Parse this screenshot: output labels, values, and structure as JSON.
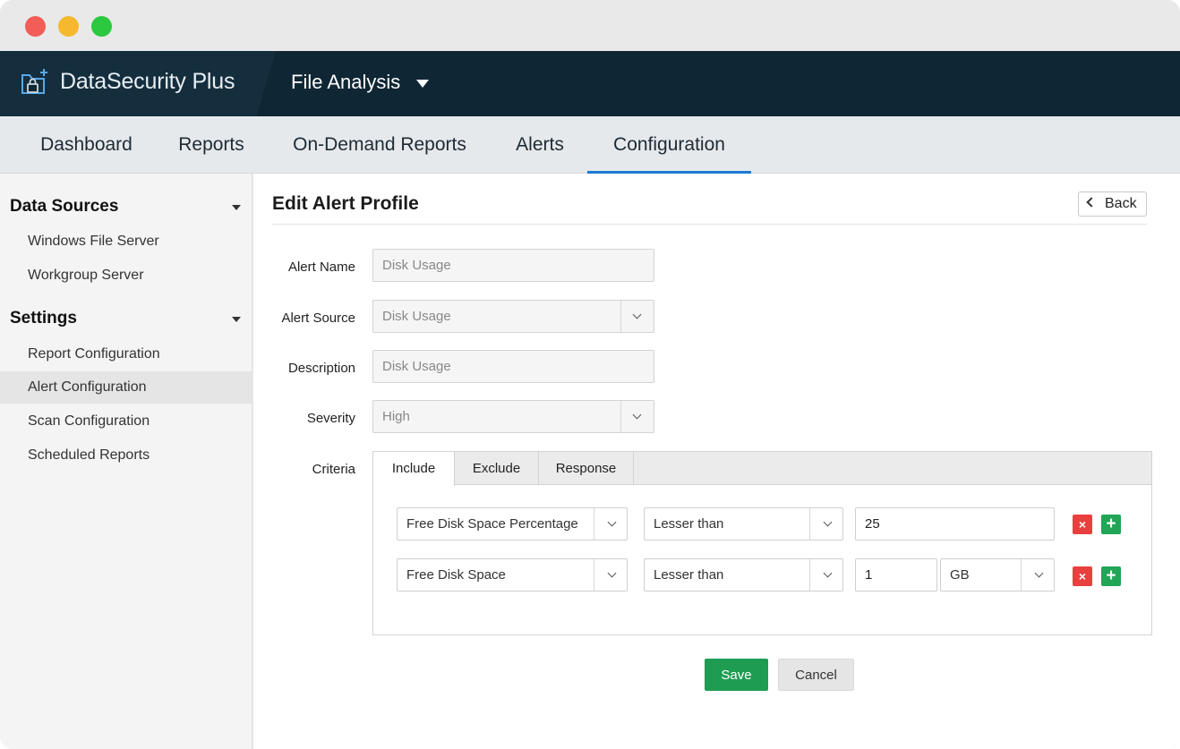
{
  "window": {
    "controls": [
      "close",
      "minimize",
      "maximize"
    ]
  },
  "header": {
    "brand": "DataSecurity Plus",
    "brand_icon": "folder-lock-icon",
    "module": "File Analysis"
  },
  "mainnav": {
    "tabs": [
      {
        "label": "Dashboard"
      },
      {
        "label": "Reports"
      },
      {
        "label": "On-Demand Reports"
      },
      {
        "label": "Alerts"
      },
      {
        "label": "Configuration",
        "active": true
      }
    ],
    "accent_color": "#1a7bd2"
  },
  "sidebar": {
    "sections": [
      {
        "title": "Data Sources",
        "items": [
          "Windows File Server",
          "Workgroup Server"
        ]
      },
      {
        "title": "Settings",
        "items": [
          "Report Configuration",
          "Alert Configuration",
          "Scan Configuration",
          "Scheduled Reports"
        ]
      }
    ],
    "active_item": "Alert Configuration"
  },
  "content": {
    "title": "Edit Alert Profile",
    "back_label": "Back",
    "form": {
      "alert_name": {
        "label": "Alert Name",
        "value": "Disk Usage"
      },
      "alert_source": {
        "label": "Alert Source",
        "value": "Disk Usage"
      },
      "description": {
        "label": "Description",
        "value": "Disk Usage"
      },
      "severity": {
        "label": "Severity",
        "value": "High"
      },
      "criteria_label": "Criteria"
    },
    "criteria": {
      "tabs": [
        "Include",
        "Exclude",
        "Response"
      ],
      "active_tab": "Include",
      "rows": [
        {
          "field": "Free Disk Space Percentage",
          "operator": "Lesser than",
          "value": "25"
        },
        {
          "field": "Free Disk Space",
          "operator": "Lesser than",
          "value": "1",
          "unit": "GB"
        }
      ]
    },
    "actions": {
      "save_label": "Save",
      "cancel_label": "Cancel",
      "save_color": "#1e9c52"
    }
  }
}
